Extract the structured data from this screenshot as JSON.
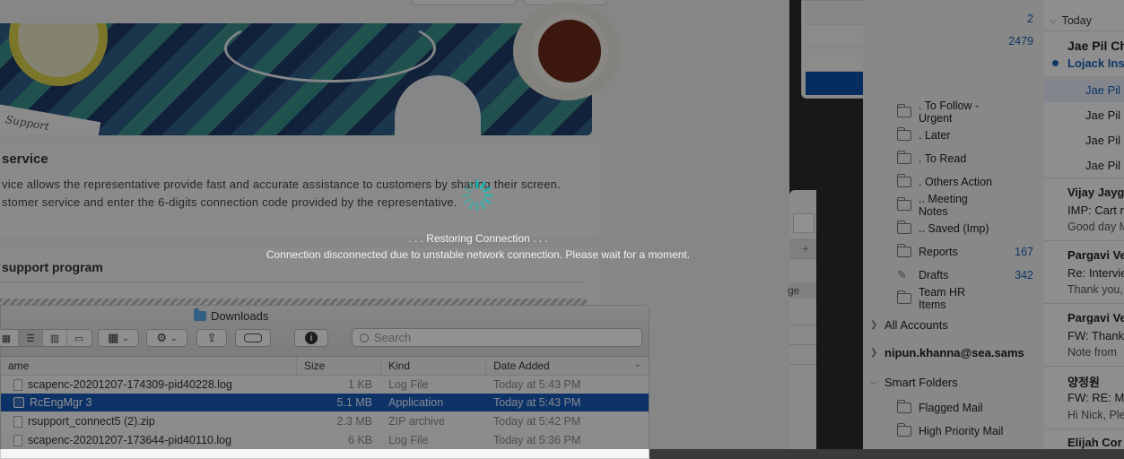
{
  "webpage": {
    "paper_text": "Support",
    "card1_title": "service",
    "card1_line1": "vice allows the representative provide fast and accurate assistance to customers by sharing their screen.",
    "card1_line2": "stomer service and enter the 6-digits connection code provided by the representative.",
    "card2_title": "support program"
  },
  "finder": {
    "title": "Downloads",
    "search_placeholder": "Search",
    "columns": {
      "name": "ame",
      "size": "Size",
      "kind": "Kind",
      "date": "Date Added"
    },
    "files": [
      {
        "name": "scapenc-20201207-174309-pid40228.log",
        "size": "1 KB",
        "kind": "Log File",
        "date": "Today at 5:43 PM"
      },
      {
        "name": "RcEngMgr 3",
        "size": "5.1 MB",
        "kind": "Application",
        "date": "Today at 5:43 PM"
      },
      {
        "name": "rsupport_connect5 (2).zip",
        "size": "2.3 MB",
        "kind": "ZIP archive",
        "date": "Today at 5:42 PM"
      },
      {
        "name": "scapenc-20201207-173644-pid40110.log",
        "size": "6 KB",
        "kind": "Log File",
        "date": "Today at 5:36 PM"
      }
    ]
  },
  "float_win": {
    "label": "ge",
    "plus": "+"
  },
  "mail_sidebar": {
    "top_counts": [
      "2",
      "2479"
    ],
    "folders": [
      {
        "label": ". To Follow - Urgent",
        "count": ""
      },
      {
        "label": ". Later",
        "count": ""
      },
      {
        "label": ". To Read",
        "count": ""
      },
      {
        "label": ". Others Action",
        "count": ""
      },
      {
        "label": ".. Meeting Notes",
        "count": ""
      },
      {
        "label": ".. Saved (Imp)",
        "count": ""
      },
      {
        "label": "Reports",
        "count": "167"
      },
      {
        "label": "Drafts",
        "count": "342"
      },
      {
        "label": "Team HR Items",
        "count": ""
      }
    ],
    "all_accounts": "All Accounts",
    "account": "nipun.khanna@sea.sams",
    "smart_folders": "Smart Folders",
    "smart_items": [
      "Flagged Mail",
      "High Priority Mail"
    ]
  },
  "mail_list": {
    "today": "Today",
    "m1_from": "Jae Pil Ch",
    "m1_subject": "Lojack Ins",
    "thread": [
      "Jae Pil",
      "Jae Pil",
      "Jae Pil",
      "Jae Pil"
    ],
    "m2_from": "Vijay Jayg",
    "m2_subject": "IMP: Cart r",
    "m2_preview": "Good day M",
    "m3_from": "Pargavi Ve",
    "m3_subject": "Re: Intervie",
    "m3_preview": "Thank you,",
    "m4_from": "Pargavi Ve",
    "m4_subject": "FW: Thank",
    "m4_preview": "Note from",
    "m5_from": "양정원",
    "m5_subject": "FW: RE: M",
    "m5_preview": "Hi Nick, Ple",
    "m6_from": "Elijah Cor"
  },
  "overlay": {
    "title": ". . . Restoring Connection . . .",
    "message": "Connection disconnected due to unstable network connection. Please wait for a moment."
  },
  "colors": {
    "selection": "#1659b7",
    "accent": "#1a5fb4",
    "spinner": "#1fbfb8"
  }
}
